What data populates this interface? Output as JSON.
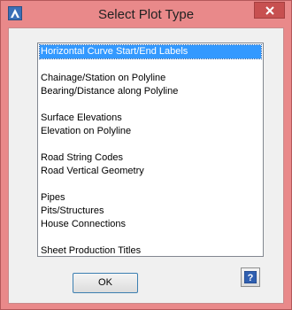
{
  "window": {
    "title": "Select Plot Type",
    "icon": "autodesk-a-icon",
    "close_icon": "close-icon"
  },
  "list": {
    "items": [
      {
        "label": "Horizontal Curve Start/End Labels",
        "selected": true
      },
      {
        "label": "Chainage/Station on Polyline",
        "selected": false
      },
      {
        "label": "Bearing/Distance along Polyline",
        "selected": false
      },
      {
        "label": "Surface Elevations",
        "selected": false
      },
      {
        "label": "Elevation on Polyline",
        "selected": false
      },
      {
        "label": "Road String Codes",
        "selected": false
      },
      {
        "label": "Road Vertical Geometry",
        "selected": false
      },
      {
        "label": "Pipes",
        "selected": false
      },
      {
        "label": "Pits/Structures",
        "selected": false
      },
      {
        "label": "House Connections",
        "selected": false
      },
      {
        "label": "Sheet Production Titles",
        "selected": false
      }
    ]
  },
  "buttons": {
    "ok_label": "OK",
    "help_icon": "help-question-icon",
    "help_glyph": "?"
  },
  "colors": {
    "frame": "#e9898a",
    "selection": "#3399ff",
    "close": "#c75050"
  }
}
